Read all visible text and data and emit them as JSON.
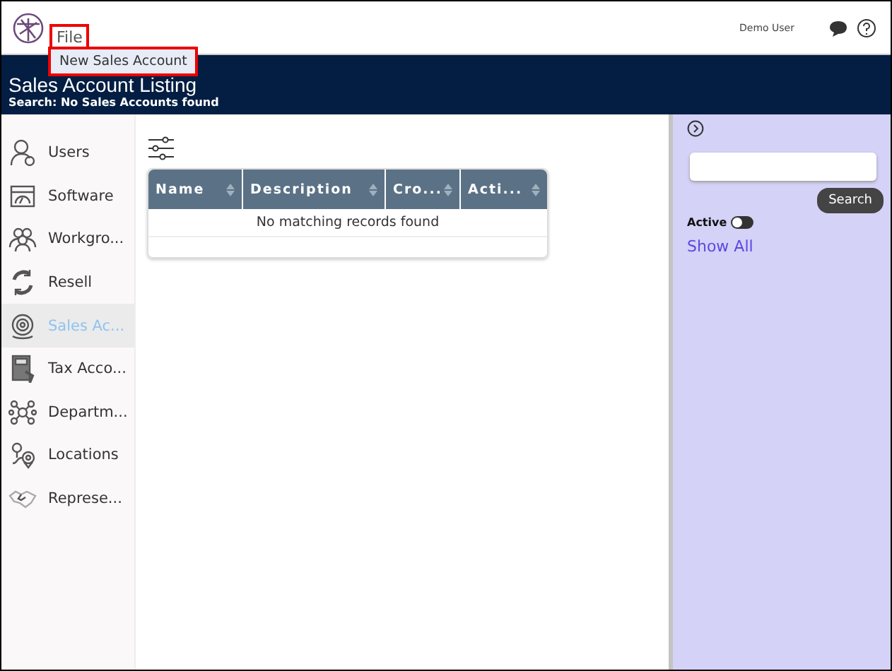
{
  "header": {
    "menu": "File",
    "menu_items": [
      "New Sales Account"
    ],
    "user": "Demo User"
  },
  "banner": {
    "title": "Sales Account Listing",
    "subtitle": "Search: No Sales Accounts found"
  },
  "sidebar": {
    "items": [
      {
        "label": "Users",
        "selected": false
      },
      {
        "label": "Software",
        "selected": false
      },
      {
        "label": "Workgro...",
        "selected": false
      },
      {
        "label": "Resell",
        "selected": false
      },
      {
        "label": "Sales Ac...",
        "selected": true
      },
      {
        "label": "Tax Acco...",
        "selected": false
      },
      {
        "label": "Departm...",
        "selected": false
      },
      {
        "label": "Locations",
        "selected": false
      },
      {
        "label": "Represe...",
        "selected": false
      }
    ]
  },
  "table": {
    "columns": [
      "Name",
      "Description",
      "Cro...",
      "Acti..."
    ],
    "empty_message": "No matching records found"
  },
  "filter_panel": {
    "search_button": "Search",
    "active": {
      "label": "Active",
      "on": false
    },
    "show_all": "Show All"
  }
}
